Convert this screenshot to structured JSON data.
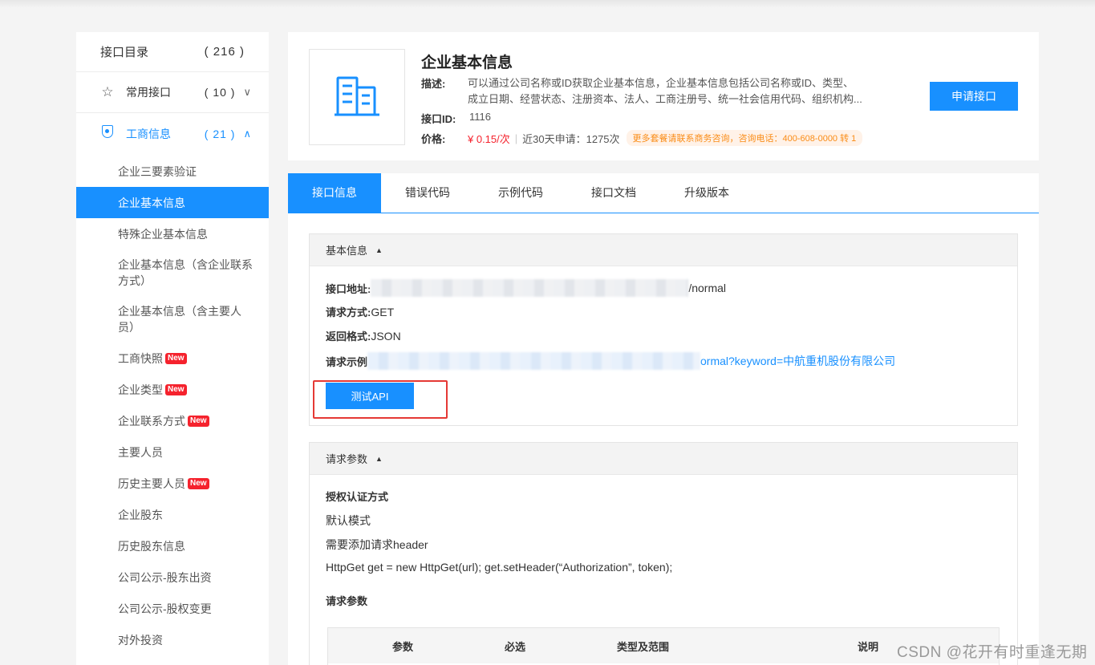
{
  "sidebar": {
    "header": {
      "label": "接口目录",
      "count": "( 216 )"
    },
    "groups": [
      {
        "label": "常用接口",
        "count": "( 10 )",
        "icon": "star-icon",
        "chevron": "∨"
      },
      {
        "label": "工商信息",
        "count": "( 21 )",
        "icon": "shield-icon",
        "chevron": "∧"
      }
    ],
    "items": [
      {
        "label": "企业三要素验证"
      },
      {
        "label": "企业基本信息"
      },
      {
        "label": "特殊企业基本信息"
      },
      {
        "label": "企业基本信息（含企业联系方式）"
      },
      {
        "label": "企业基本信息（含主要人员）"
      },
      {
        "label": "工商快照",
        "badge": "New"
      },
      {
        "label": "企业类型",
        "badge": "New"
      },
      {
        "label": "企业联系方式",
        "badge": "New"
      },
      {
        "label": "主要人员"
      },
      {
        "label": "历史主要人员",
        "badge": "New"
      },
      {
        "label": "企业股东"
      },
      {
        "label": "历史股东信息"
      },
      {
        "label": "公司公示-股东出资"
      },
      {
        "label": "公司公示-股权变更"
      },
      {
        "label": "对外投资"
      }
    ]
  },
  "product": {
    "title": "企业基本信息",
    "desc_label": "描述:",
    "desc_line1": "可以通过公司名称或ID获取企业基本信息，企业基本信息包括公司名称或ID、类型、",
    "desc_line2": "成立日期、经营状态、注册资本、法人、工商注册号、统一社会信用代码、组织机构...",
    "id_label": "接口ID:",
    "id_value": "1116",
    "price_label": "价格:",
    "price_value": "¥ 0.15/次",
    "recent_text": "近30天申请：1275次",
    "promo_text": "更多套餐请联系商务咨询，咨询电话：400-608-0000 转 1",
    "apply_button": "申请接口"
  },
  "tabs": [
    {
      "label": "接口信息"
    },
    {
      "label": "错误代码"
    },
    {
      "label": "示例代码"
    },
    {
      "label": "接口文档"
    },
    {
      "label": "升级版本"
    }
  ],
  "basic_info": {
    "title": "基本信息",
    "address_label": "接口地址:",
    "address_suffix": "/normal",
    "method_label": "请求方式:",
    "method_value": "GET",
    "format_label": "返回格式:",
    "format_value": "JSON",
    "example_label": "请求示例",
    "example_suffix": "ormal?keyword=中航重机股份有限公司",
    "test_button": "测试API"
  },
  "request_params": {
    "title": "请求参数",
    "auth_heading": "授权认证方式",
    "auth_mode": "默认模式",
    "header_note": "需要添加请求header",
    "code_line": "HttpGet get = new HttpGet(url); get.setHeader(“Authorization”, token);",
    "params_heading": "请求参数",
    "columns": [
      "参数",
      "必选",
      "类型及范围",
      "说明"
    ]
  },
  "watermark": "CSDN @花开有时重逢无期"
}
